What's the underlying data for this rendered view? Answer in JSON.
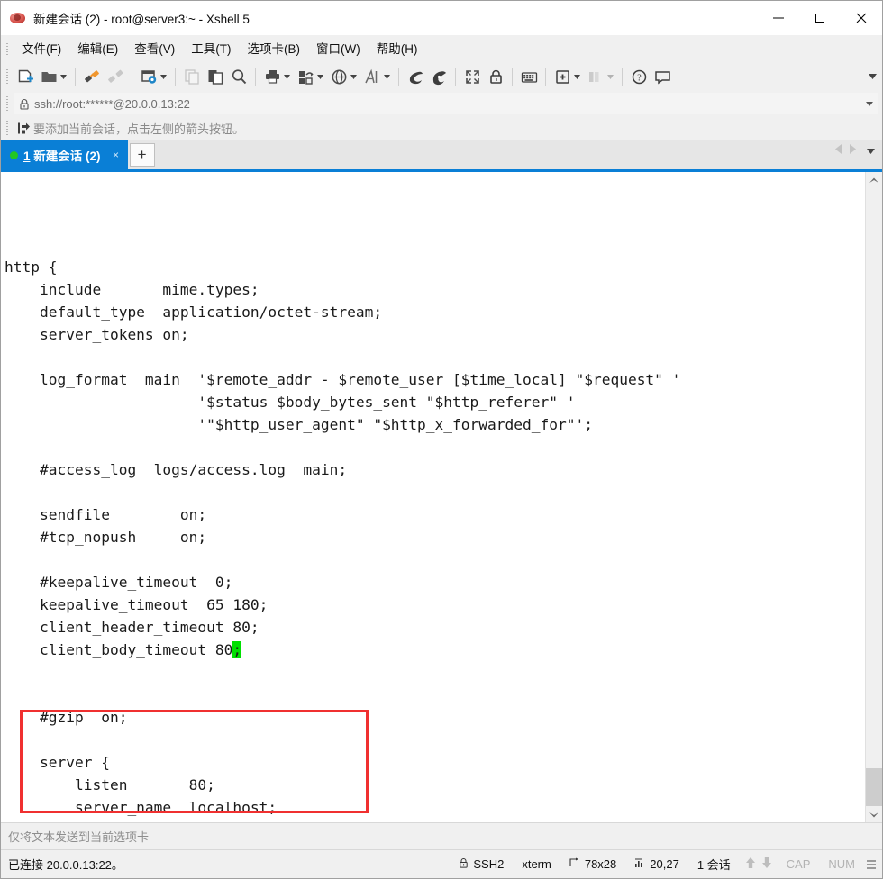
{
  "window": {
    "title": "新建会话 (2) - root@server3:~ - Xshell 5",
    "app_icon": "xshell-icon",
    "minimize_label": "—",
    "maximize_label": "□",
    "close_label": "✕"
  },
  "menu": {
    "items": [
      {
        "name": "menu-file",
        "text": "文件(F)",
        "pre": "文件(",
        "key": "F",
        "post": ")"
      },
      {
        "name": "menu-edit",
        "text": "编辑(E)",
        "pre": "编辑(",
        "key": "E",
        "post": ")"
      },
      {
        "name": "menu-view",
        "text": "查看(V)",
        "pre": "查看(",
        "key": "V",
        "post": ")"
      },
      {
        "name": "menu-tools",
        "text": "工具(T)",
        "pre": "工具(",
        "key": "T",
        "post": ")"
      },
      {
        "name": "menu-tabs",
        "text": "选项卡(B)",
        "pre": "选项卡(",
        "key": "B",
        "post": ")"
      },
      {
        "name": "menu-window",
        "text": "窗口(W)",
        "pre": "窗口(",
        "key": "W",
        "post": ")"
      },
      {
        "name": "menu-help",
        "text": "帮助(H)",
        "pre": "帮助(",
        "key": "H",
        "post": ")"
      }
    ]
  },
  "toolbar": {
    "buttons": [
      {
        "name": "new-session-icon",
        "icon": "new-file-plus",
        "caret": false,
        "disabled": false
      },
      {
        "name": "open-session-icon",
        "icon": "open-folder",
        "caret": true,
        "disabled": false
      },
      {
        "name": "connect-icon",
        "icon": "plug-connect",
        "caret": false,
        "disabled": false
      },
      {
        "name": "disconnect-icon",
        "icon": "plug-disconnect",
        "caret": false,
        "disabled": true
      },
      {
        "name": "properties-icon",
        "icon": "window-gear",
        "caret": true,
        "disabled": false
      },
      {
        "name": "copy-icon",
        "icon": "copy-pages",
        "caret": false,
        "disabled": true
      },
      {
        "name": "paste-icon",
        "icon": "paste-clipboard",
        "caret": false,
        "disabled": false
      },
      {
        "name": "find-icon",
        "icon": "magnifier",
        "caret": false,
        "disabled": false
      },
      {
        "name": "print-icon",
        "icon": "printer",
        "caret": true,
        "disabled": false
      },
      {
        "name": "transfer-icon",
        "icon": "file-transfer",
        "caret": true,
        "disabled": false
      },
      {
        "name": "browser-icon",
        "icon": "globe",
        "caret": true,
        "disabled": false
      },
      {
        "name": "font-icon",
        "icon": "letter-a",
        "caret": true,
        "disabled": false
      },
      {
        "name": "xftp-icon",
        "icon": "shell-dark",
        "caret": false,
        "disabled": false
      },
      {
        "name": "xshell-sub-icon",
        "icon": "shell-cut",
        "caret": false,
        "disabled": false
      },
      {
        "name": "fullscreen-icon",
        "icon": "expand-arrows",
        "caret": false,
        "disabled": false
      },
      {
        "name": "lock-icon",
        "icon": "padlock",
        "caret": false,
        "disabled": false
      },
      {
        "name": "keyboard-icon",
        "icon": "keyboard",
        "caret": false,
        "disabled": false
      },
      {
        "name": "add-to-folder-icon",
        "icon": "folder-plus",
        "caret": true,
        "disabled": false
      },
      {
        "name": "layout-icon",
        "icon": "panes",
        "caret": true,
        "disabled": true
      },
      {
        "name": "help-icon",
        "icon": "question-circle",
        "caret": false,
        "disabled": false
      },
      {
        "name": "feedback-icon",
        "icon": "speech-bubble",
        "caret": false,
        "disabled": false
      }
    ],
    "overflow_label": "▾"
  },
  "address_bar": {
    "lock_icon": "lock-icon",
    "value": "ssh://root:******@20.0.0.13:22",
    "placeholder": "ssh://",
    "dropdown_label": "▾"
  },
  "hint_bar": {
    "icon": "arrow-into-box-icon",
    "text": "要添加当前会话，点击左侧的箭头按钮。"
  },
  "tabs": {
    "items": [
      {
        "name": "tab-session-1",
        "index": "1",
        "label": "新建会话 (2)",
        "status_dot": "connected",
        "close_label": "×",
        "selected": true
      }
    ],
    "new_tab_label": "+",
    "nav_prev_label": "◂",
    "nav_next_label": "▸",
    "nav_menu_label": "▾"
  },
  "terminal": {
    "accent_cursor_color": "#00e000",
    "background": "#ffffff",
    "foreground": "#1a1a1a",
    "lines": [
      "",
      "http {",
      "    include       mime.types;",
      "    default_type  application/octet-stream;",
      "    server_tokens on;",
      "",
      "    log_format  main  '$remote_addr - $remote_user [$time_local] \"$request\" '",
      "                      '$status $body_bytes_sent \"$http_referer\" '",
      "                      '\"$http_user_agent\" \"$http_x_forwarded_for\"';",
      "",
      "    #access_log  logs/access.log  main;",
      "",
      "    sendfile        on;",
      "    #tcp_nopush     on;",
      "",
      "    #keepalive_timeout  0;",
      "    keepalive_timeout  65 180;",
      "    client_header_timeout 80;",
      "",
      "",
      "    #gzip  on;",
      "",
      "    server {",
      "        listen       80;",
      "        server_name  localhost;"
    ],
    "cursor_line_prefix": "    client_body_timeout 80",
    "cursor_char": ";",
    "annotation": {
      "name": "red-highlight-box",
      "color": "#f03030"
    }
  },
  "send_bar": {
    "text": "仅将文本发送到当前选项卡"
  },
  "status_bar": {
    "connection": "已连接 20.0.0.13:22。",
    "protocol_icon": "lock-icon",
    "protocol": "SSH2",
    "terminal_type": "xterm",
    "size_icon": "size-icon",
    "size": "78x28",
    "cursor_icon": "cursor-icon",
    "cursor_pos": "20,27",
    "sessions": "1 会话",
    "scroll_up_label": "↑",
    "scroll_down_label": "↓",
    "caps_label": "CAP",
    "num_label": "NUM"
  }
}
